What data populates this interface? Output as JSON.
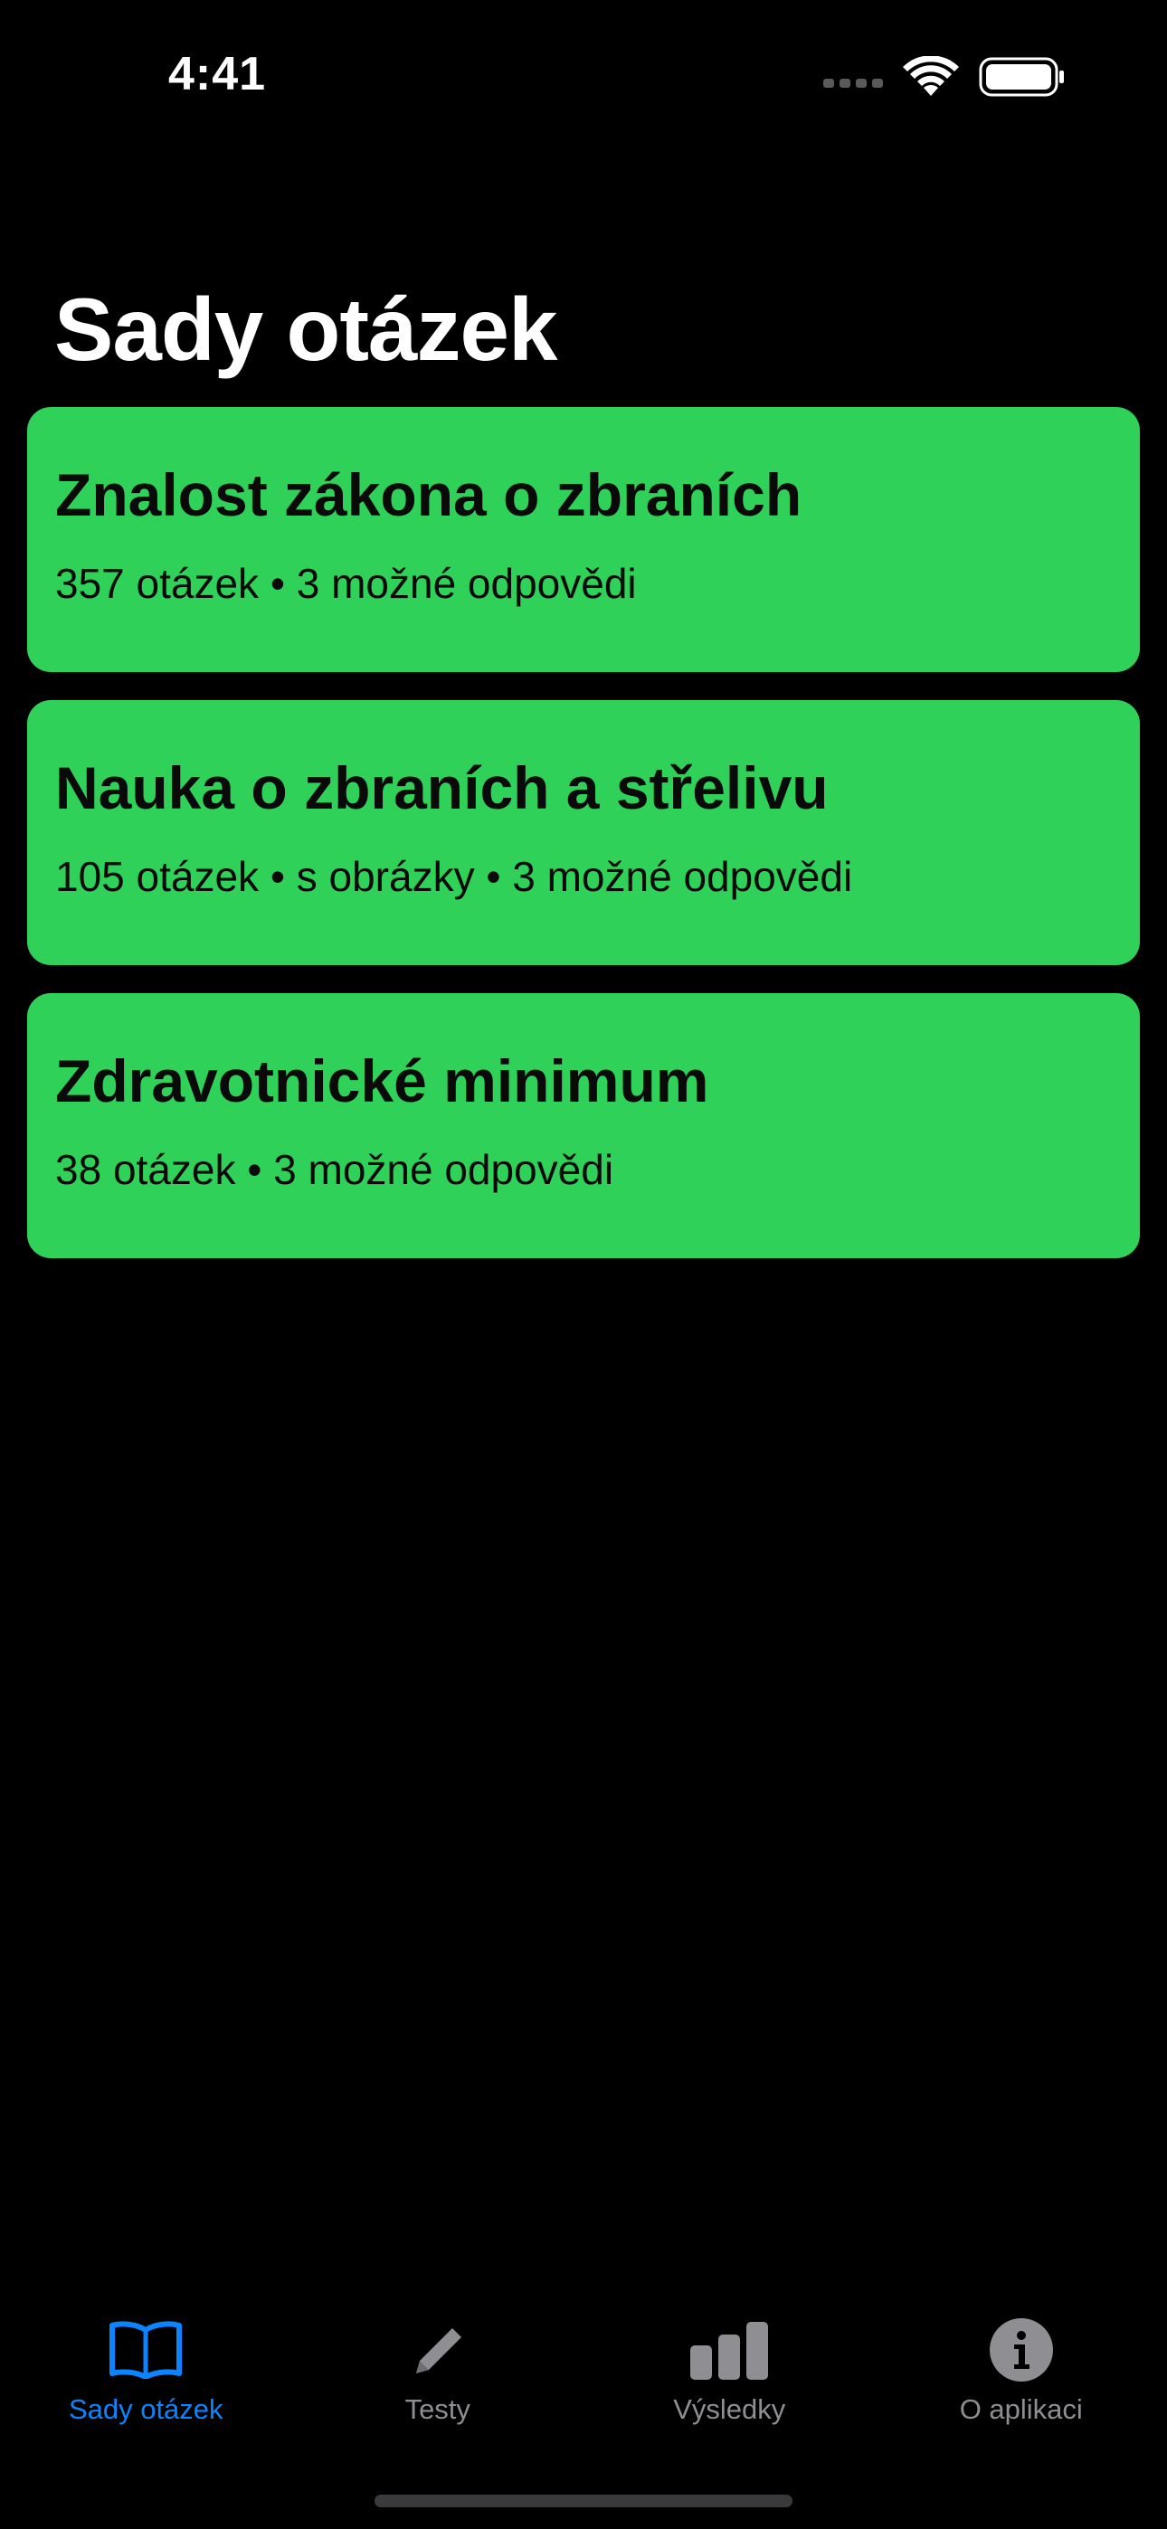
{
  "status_bar": {
    "time": "4:41"
  },
  "page": {
    "title": "Sady otázek"
  },
  "question_sets": [
    {
      "title": "Znalost zákona o zbraních",
      "subtitle": "357 otázek • 3 možné odpovědi"
    },
    {
      "title": "Nauka o zbraních a střelivu",
      "subtitle": "105 otázek • s obrázky • 3 možné odpovědi"
    },
    {
      "title": "Zdravotnické minimum",
      "subtitle": "38 otázek • 3 možné odpovědi"
    }
  ],
  "tab_bar": {
    "tabs": [
      {
        "label": "Sady otázek",
        "icon": "book-icon",
        "active": true
      },
      {
        "label": "Testy",
        "icon": "pencil-icon",
        "active": false
      },
      {
        "label": "Výsledky",
        "icon": "bar-chart-icon",
        "active": false
      },
      {
        "label": "O aplikaci",
        "icon": "info-icon",
        "active": false
      }
    ]
  },
  "colors": {
    "card_background": "#30d158",
    "tab_active": "#0a84ff",
    "tab_inactive": "#8e8e93",
    "background": "#000000"
  }
}
